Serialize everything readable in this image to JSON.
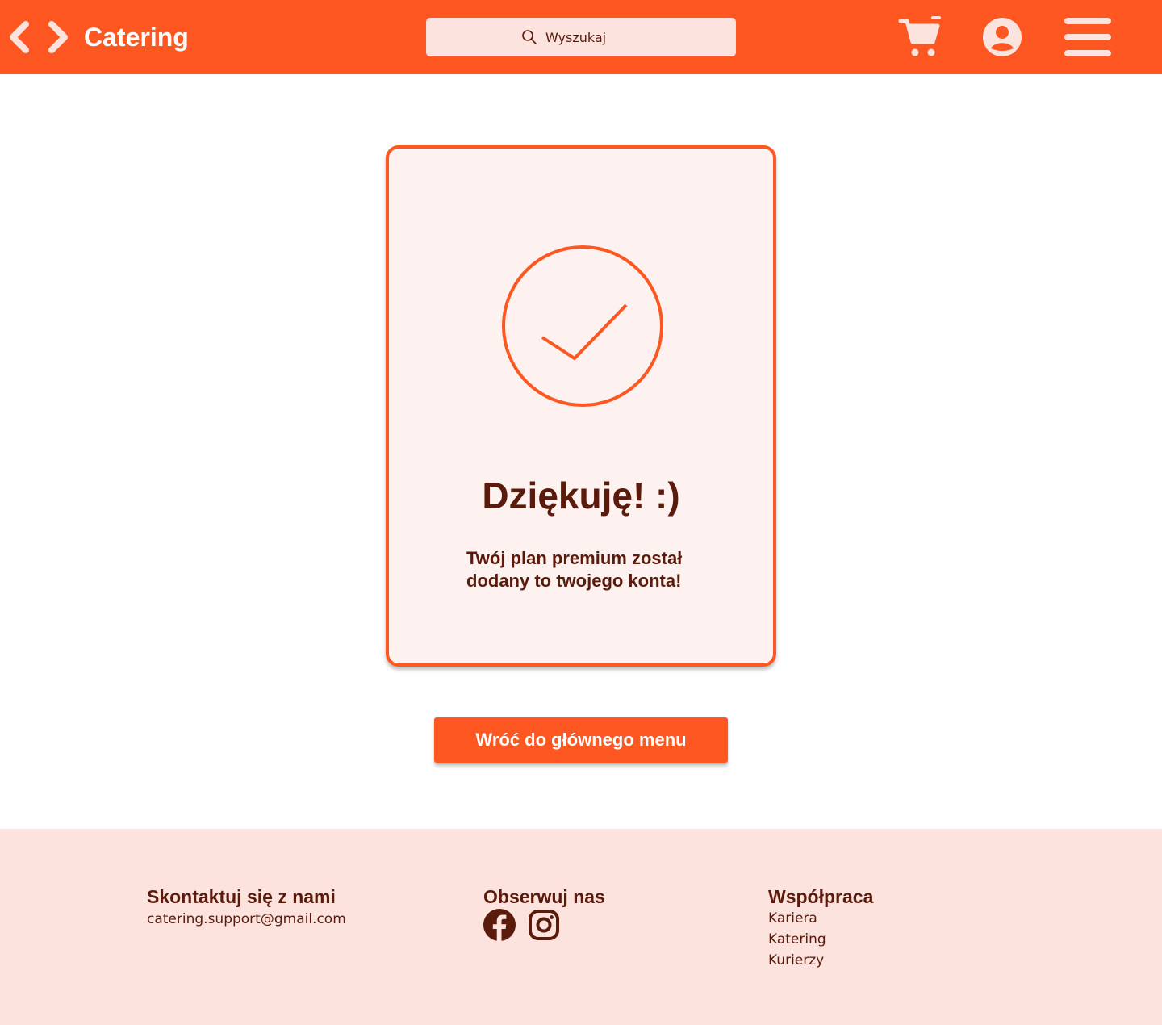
{
  "header": {
    "brand": "Catering",
    "search": {
      "placeholder": "Wyszukaj",
      "value": ""
    },
    "icons": {
      "back": "chevron-left-icon",
      "forward": "chevron-right-icon",
      "search": "search-icon",
      "cart": "cart-icon",
      "account": "user-icon",
      "menu": "hamburger-menu-icon"
    }
  },
  "confirmation": {
    "icon": "checkmark-circle-icon",
    "title": "Dziękuję! :)",
    "message": "Twój plan premium został dodany to twojego konta!"
  },
  "actions": {
    "back_to_menu_label": "Wróć do głównego menu"
  },
  "footer": {
    "contact": {
      "heading": "Skontaktuj się z nami",
      "email": "catering.support@gmail.com"
    },
    "follow": {
      "heading": "Obserwuj nas",
      "icons": [
        "facebook-icon",
        "instagram-icon"
      ]
    },
    "cooperation": {
      "heading": "Współpraca",
      "links": [
        "Kariera",
        "Katering",
        "Kurierzy"
      ]
    }
  },
  "colors": {
    "accent": "#ff5722",
    "text_dark": "#5a1a0c",
    "card_background": "#fdf2ef",
    "search_background": "#fde3dd",
    "footer_background": "#fde3dd"
  }
}
